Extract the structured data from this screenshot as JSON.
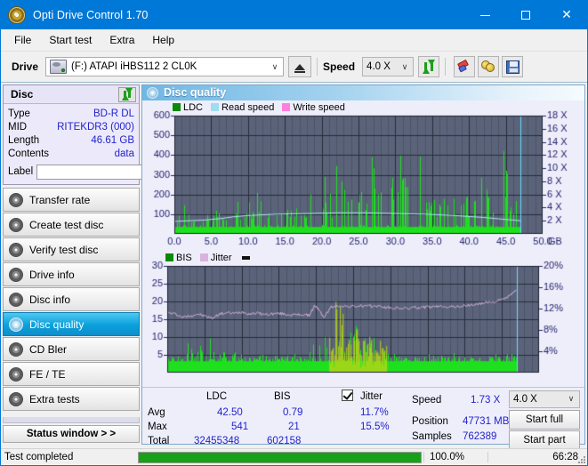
{
  "window": {
    "title": "Opti Drive Control 1.70",
    "icon": "disc-icon",
    "minimize": "–",
    "maximize": "□",
    "close": "✕"
  },
  "menu": [
    "File",
    "Start test",
    "Extra",
    "Help"
  ],
  "toolbar": {
    "drive_label": "Drive",
    "drive_value": "(F:)  ATAPI iHBS112  2 CL0K",
    "eject_icon": "eject-icon",
    "speed_label": "Speed",
    "speed_value": "4.0 X",
    "refresh_icon": "refresh-icon",
    "erase_icon": "erase-icon",
    "gold_icon": "gold-discs-icon",
    "save_icon": "save-icon",
    "dropdown_arrow": "∨"
  },
  "disc_panel": {
    "header": "Disc",
    "refresh_icon": "refresh-icon",
    "rows": [
      {
        "key": "Type",
        "value": "BD-R DL"
      },
      {
        "key": "MID",
        "value": "RITEKDR3 (000)"
      },
      {
        "key": "Length",
        "value": "46.61 GB"
      },
      {
        "key": "Contents",
        "value": "data"
      }
    ],
    "label_key": "Label",
    "label_value": "",
    "label_placeholder": "",
    "label_button_icon": "disc-icon"
  },
  "sidebar": {
    "items": [
      {
        "label": "Transfer rate",
        "icon": "disc-icon",
        "active": false
      },
      {
        "label": "Create test disc",
        "icon": "disc-icon",
        "active": false
      },
      {
        "label": "Verify test disc",
        "icon": "disc-icon",
        "active": false
      },
      {
        "label": "Drive info",
        "icon": "disc-icon",
        "active": false
      },
      {
        "label": "Disc info",
        "icon": "disc-icon",
        "active": false
      },
      {
        "label": "Disc quality",
        "icon": "disc-icon",
        "active": true
      },
      {
        "label": "CD Bler",
        "icon": "disc-icon",
        "active": false
      },
      {
        "label": "FE / TE",
        "icon": "disc-icon",
        "active": false
      },
      {
        "label": "Extra tests",
        "icon": "disc-icon",
        "active": false
      }
    ],
    "status_window": "Status window > >"
  },
  "panel": {
    "title": "Disc quality",
    "icon": "disc-icon"
  },
  "stats": {
    "col_ldc": "LDC",
    "col_bis": "BIS",
    "jitter_label": "Jitter",
    "jitter_checked": true,
    "rows": [
      {
        "name": "Avg",
        "ldc": "42.50",
        "bis": "0.79",
        "jitter": "11.7%"
      },
      {
        "name": "Max",
        "ldc": "541",
        "bis": "21",
        "jitter": "15.5%"
      },
      {
        "name": "Total",
        "ldc": "32455348",
        "bis": "602158",
        "jitter": ""
      }
    ],
    "speed_label": "Speed",
    "speed_value": "1.73 X",
    "position_label": "Position",
    "position_value": "47731 MB",
    "samples_label": "Samples",
    "samples_value": "762389",
    "speed_select": "4.0 X",
    "start_full": "Start full",
    "start_part": "Start part",
    "dropdown_arrow": "∨"
  },
  "statusbar": {
    "message": "Test completed",
    "percent_text": "100.0%",
    "percent": 100,
    "time": "66:28"
  },
  "colors": {
    "accent": "#0078d7",
    "plot_bg": "#5a6379",
    "grid": "#3b4354",
    "ldc_green": "#1ee01e",
    "read_speed": "#7fdcf5",
    "write_speed": "#ff7fe0",
    "jitter_pink": "#d9b3dd",
    "bis_green": "#1ee01e",
    "value_blue": "#2222cc",
    "progress_green": "#18a018",
    "cursor_cyan": "#66e0ff"
  },
  "chart_data": [
    {
      "type": "area",
      "id": "ldc-chart",
      "title": "",
      "legend": [
        {
          "label": "LDC",
          "color": "#0a8a0a"
        },
        {
          "label": "Read speed",
          "color": "#9fdcf0"
        },
        {
          "label": "Write speed",
          "color": "#ff7fe0"
        }
      ],
      "legend_position": "top-left",
      "xlabel": "GB",
      "x_ticks": [
        "0.0",
        "5.0",
        "10.0",
        "15.0",
        "20.0",
        "25.0",
        "30.0",
        "35.0",
        "40.0",
        "45.0",
        "50.0"
      ],
      "xlim": [
        0,
        50
      ],
      "ylabel_left": "LDC",
      "y_ticks_left": [
        "100",
        "200",
        "300",
        "400",
        "500",
        "600"
      ],
      "ylim_left": [
        0,
        600
      ],
      "ylabel_right": "Speed",
      "y_ticks_right": [
        "2 X",
        "4 X",
        "6 X",
        "8 X",
        "10 X",
        "12 X",
        "14 X",
        "16 X",
        "18 X"
      ],
      "ylim_right": [
        0,
        18
      ],
      "grid": true,
      "data_end_x": 47.0,
      "cursor_x": 47.0,
      "series": [
        {
          "name": "LDC",
          "color": "#1ee01e",
          "kind": "spike-area",
          "baseline": 35,
          "x": [
            0.3,
            1.0,
            1.6,
            2.2,
            2.8,
            3.4,
            4.0,
            4.6,
            5.2,
            5.8,
            6.4,
            7.0,
            7.6,
            8.2,
            8.8,
            9.4,
            10.0,
            10.6,
            11.2,
            11.8,
            12.4,
            13.0,
            13.6,
            14.2,
            14.8,
            15.4,
            16.0,
            16.6,
            17.2,
            17.8,
            18.4,
            19.0,
            19.6,
            20.2,
            20.8,
            21.4,
            22.0,
            22.6,
            23.2,
            23.8,
            24.4,
            25.0,
            25.6,
            26.2,
            26.8,
            27.4,
            28.0,
            28.6,
            29.2,
            29.8,
            30.4,
            31.0,
            31.6,
            32.2,
            32.8,
            33.4,
            34.0,
            34.6,
            35.2,
            35.8,
            36.4,
            37.0,
            37.6,
            38.2,
            38.8,
            39.4,
            40.0,
            40.6,
            41.2,
            41.8,
            42.4,
            43.0,
            43.6,
            44.2,
            44.8,
            45.4,
            46.0,
            46.6
          ],
          "y": [
            60,
            240,
            120,
            90,
            100,
            150,
            80,
            95,
            110,
            130,
            160,
            90,
            170,
            185,
            150,
            120,
            170,
            100,
            395,
            130,
            120,
            180,
            150,
            165,
            110,
            120,
            140,
            175,
            150,
            130,
            200,
            160,
            230,
            290,
            250,
            180,
            440,
            535,
            390,
            420,
            470,
            300,
            300,
            250,
            400,
            380,
            260,
            500,
            430,
            380,
            280,
            520,
            320,
            400,
            310,
            450,
            260,
            220,
            200,
            180,
            300,
            250,
            210,
            190,
            360,
            180,
            200,
            230,
            330,
            430,
            220,
            300,
            180,
            420,
            470,
            170,
            200,
            240
          ]
        },
        {
          "name": "Read speed",
          "color": "#aee9f7",
          "kind": "line",
          "axis": "right",
          "x": [
            0.0,
            2.0,
            4.0,
            6.0,
            8.0,
            10.0,
            14.0,
            18.0,
            22.0,
            23.3,
            26.0,
            30.0,
            34.0,
            38.0,
            42.0,
            44.0,
            46.0,
            47.0
          ],
          "y": [
            1.9,
            2.0,
            2.1,
            2.3,
            2.6,
            2.8,
            3.0,
            3.1,
            3.2,
            3.2,
            3.2,
            3.1,
            3.0,
            2.8,
            2.5,
            2.3,
            2.1,
            2.0
          ]
        }
      ]
    },
    {
      "type": "area",
      "id": "bis-chart",
      "title": "",
      "legend": [
        {
          "label": "BIS",
          "color": "#0a8a0a"
        },
        {
          "label": "Jitter",
          "color": "#d9b3dd"
        }
      ],
      "legend_position": "top-left",
      "xlabel": "GB",
      "x_ticks": [
        "0.0",
        "5.0",
        "10.0",
        "15.0",
        "20.0",
        "25.0",
        "30.0",
        "35.0",
        "40.0",
        "45.0",
        "50.0"
      ],
      "xlim": [
        0,
        50
      ],
      "ylabel_left": "BIS",
      "y_ticks_left": [
        "5",
        "10",
        "15",
        "20",
        "25",
        "30"
      ],
      "ylim_left": [
        0,
        30
      ],
      "ylabel_right": "Jitter",
      "y_ticks_right": [
        "4%",
        "8%",
        "12%",
        "16%",
        "20%"
      ],
      "ylim_right": [
        0,
        20
      ],
      "grid": true,
      "data_end_x": 47.0,
      "cursor_x": 47.0,
      "series": [
        {
          "name": "BIS",
          "color": "#1ee01e",
          "kind": "spike-area",
          "baseline": 3.2,
          "x": [
            0.3,
            1.0,
            1.6,
            2.2,
            2.8,
            3.4,
            4.0,
            4.6,
            5.2,
            5.8,
            6.4,
            7.0,
            7.6,
            8.2,
            8.8,
            9.4,
            10.0,
            10.6,
            11.2,
            11.8,
            12.4,
            13.0,
            13.6,
            14.2,
            14.8,
            15.4,
            16.0,
            16.6,
            17.2,
            17.8,
            18.4,
            19.0,
            19.6,
            20.2,
            20.8,
            21.4,
            22.0,
            22.6,
            23.2,
            23.8,
            24.4,
            25.0,
            25.6,
            26.2,
            26.8,
            27.4,
            28.0,
            28.6,
            29.2,
            29.8,
            30.4,
            31.0,
            31.6,
            32.2,
            32.8,
            33.4,
            34.0,
            34.6,
            35.2,
            35.8,
            36.4,
            37.0,
            37.6,
            38.2,
            38.8,
            39.4,
            40.0,
            40.6,
            41.2,
            41.8,
            42.4,
            43.0,
            43.6,
            44.2,
            44.8,
            45.4,
            46.0,
            46.6
          ],
          "y": [
            4.3,
            4.8,
            5.4,
            5.1,
            8.5,
            6.5,
            7.0,
            9.5,
            6.2,
            10.2,
            6.3,
            5.6,
            6.4,
            5.2,
            5.8,
            6.0,
            5.4,
            5.2,
            6.2,
            5.0,
            5.6,
            6.8,
            5.4,
            5.3,
            6.0,
            5.4,
            5.2,
            6.4,
            5.0,
            5.6,
            6.2,
            5.5,
            13.2,
            9.8,
            10.6,
            9.5,
            11.2,
            21.0,
            13.0,
            10.0,
            9.4,
            15.2,
            11.0,
            9.8,
            9.6,
            9.0,
            9.4,
            8.6,
            8.2,
            5.0,
            5.2,
            5.3,
            5.0,
            5.4,
            5.2,
            5.6,
            5.2,
            5.5,
            6.2,
            5.4,
            5.2,
            5.8,
            5.4,
            5.2,
            6.0,
            5.6,
            5.2,
            4.8,
            4.4,
            6.4,
            6.0,
            6.4,
            5.4,
            5.6,
            6.2,
            5.8,
            6.4,
            5.8
          ]
        },
        {
          "name": "Jitter",
          "color": "#d9b3dd",
          "kind": "noisy-line",
          "axis": "right",
          "x": [
            0.0,
            1.0,
            2.0,
            3.0,
            4.0,
            5.0,
            6.0,
            7.0,
            8.0,
            9.0,
            10.0,
            11.0,
            12.0,
            13.0,
            14.0,
            15.0,
            16.0,
            17.0,
            18.0,
            19.0,
            19.8,
            20.2,
            21.0,
            22.0,
            22.8,
            23.2,
            24.0,
            25.0,
            26.0,
            27.0,
            28.0,
            29.0,
            30.0,
            31.0,
            32.0,
            33.0,
            34.0,
            35.0,
            36.0,
            37.0,
            38.0,
            39.0,
            40.0,
            41.0,
            42.0,
            43.0,
            44.0,
            45.0,
            46.0,
            46.8
          ],
          "y": [
            11.2,
            11.0,
            10.4,
            10.6,
            11.0,
            10.6,
            10.2,
            11.0,
            11.2,
            11.1,
            11.4,
            11.0,
            11.2,
            10.9,
            11.0,
            11.1,
            10.9,
            10.8,
            10.9,
            10.7,
            12.6,
            11.9,
            10.4,
            12.3,
            12.4,
            12.6,
            12.4,
            12.4,
            12.5,
            12.4,
            12.5,
            12.3,
            12.1,
            12.1,
            12.0,
            12.2,
            12.2,
            12.3,
            12.3,
            12.5,
            12.3,
            12.4,
            12.5,
            12.7,
            12.9,
            13.2,
            13.3,
            13.7,
            14.4,
            15.3
          ]
        }
      ]
    }
  ]
}
